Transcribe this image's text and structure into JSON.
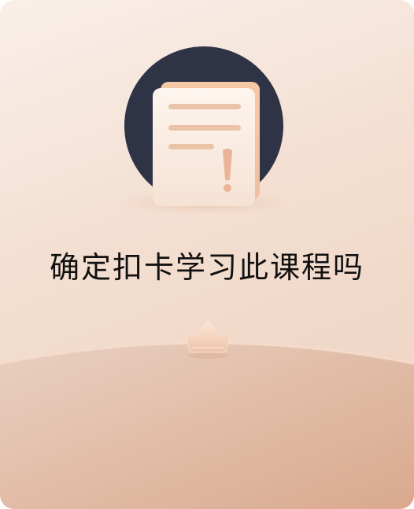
{
  "dialog": {
    "title": "确定扣卡学习此课程吗",
    "icons": {
      "illustration": "document-warning-icon",
      "decoration": "crown-icon"
    },
    "colors": {
      "background_light": "#f9efe9",
      "background_dark": "#edd1bf",
      "circle": "#2f3346",
      "document": "#fbeee4",
      "accent": "#e8b89a",
      "title_text": "#111111"
    }
  }
}
